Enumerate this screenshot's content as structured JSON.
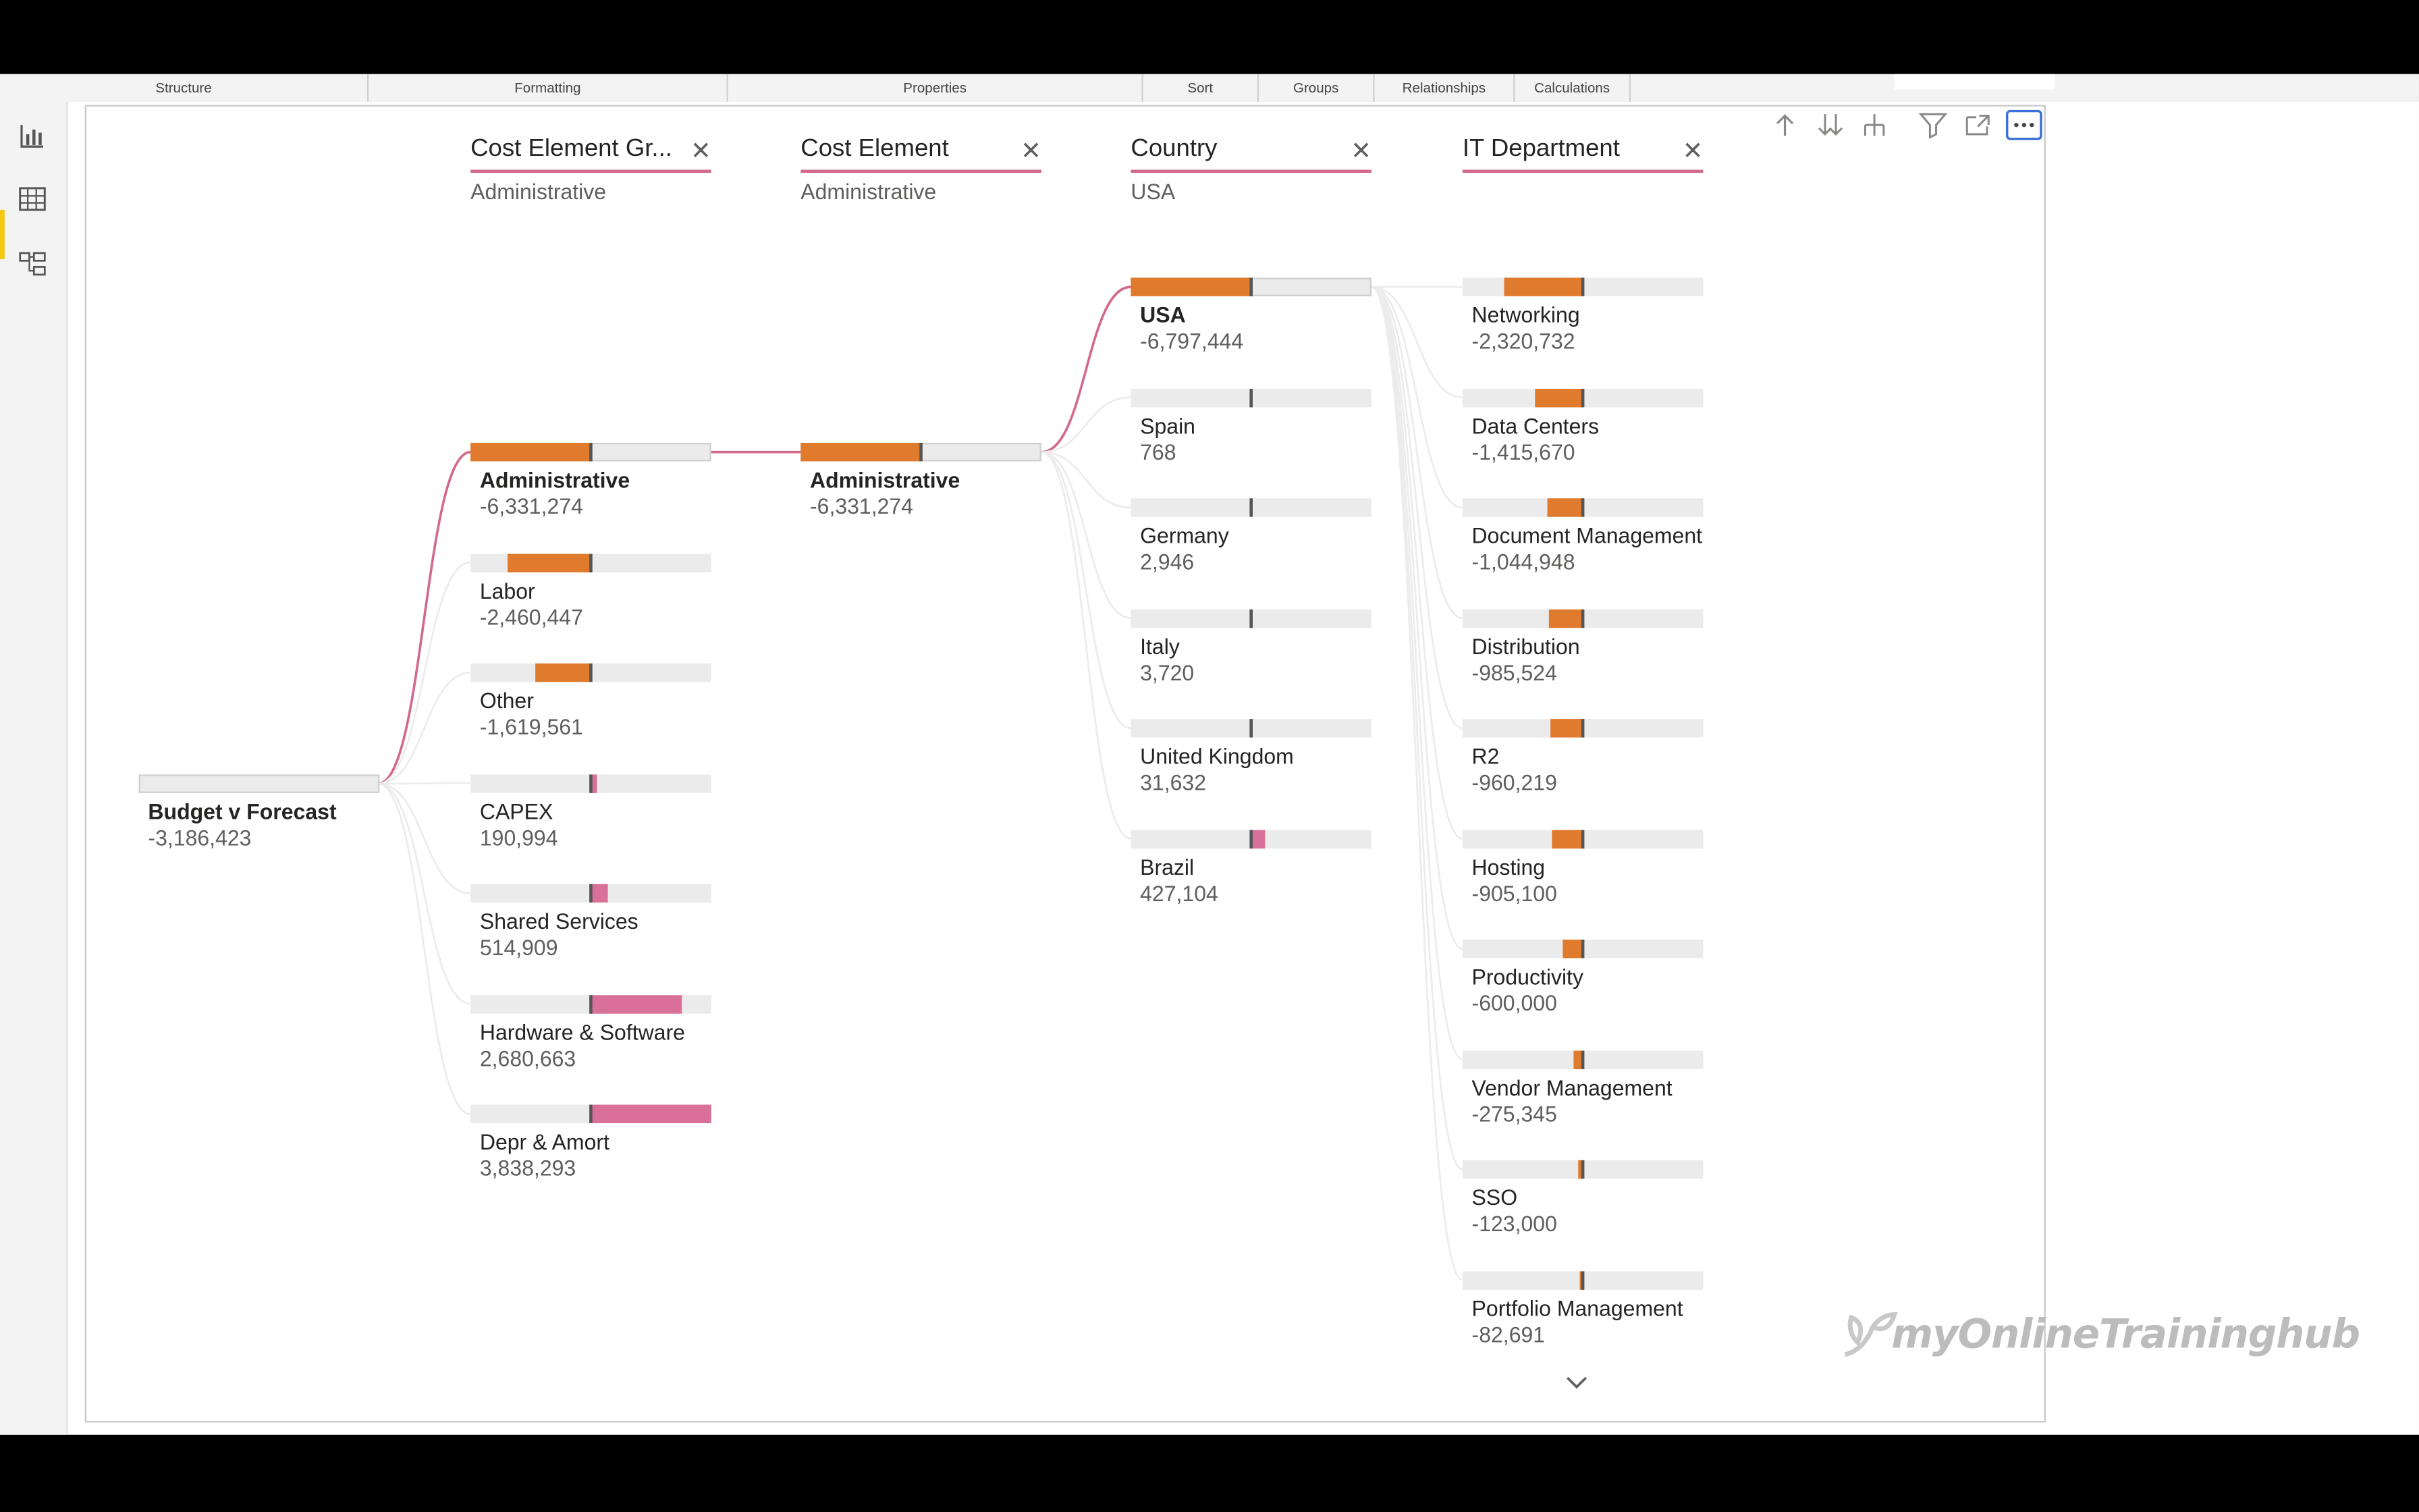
{
  "ribbon": {
    "groups": [
      "Structure",
      "Formatting",
      "Properties",
      "Sort",
      "Groups",
      "Relationships",
      "Calculations"
    ]
  },
  "left_rail": {
    "icons": [
      "report-view-icon",
      "data-view-icon",
      "model-view-icon"
    ]
  },
  "toolbar": {
    "icons": [
      "drill-up-icon",
      "expand-all-icon",
      "hierarchy-icon",
      "filter-icon",
      "focus-mode-icon",
      "more-options-icon"
    ]
  },
  "colors": {
    "negative": "#e07a2c",
    "positive": "#d9709a",
    "link": "#d26a8a",
    "track": "#ebebeb"
  },
  "root": {
    "label": "Budget v Forecast",
    "value": "-3,186,423",
    "num": -3186423
  },
  "levels": [
    {
      "header": "Cost Element Gr...",
      "subtitle": "Administrative",
      "nodes": [
        {
          "label": "Administrative",
          "value": "-6,331,274",
          "num": -6331274,
          "selected": true
        },
        {
          "label": "Labor",
          "value": "-2,460,447",
          "num": -2460447
        },
        {
          "label": "Other",
          "value": "-1,619,561",
          "num": -1619561
        },
        {
          "label": "CAPEX",
          "value": "190,994",
          "num": 190994
        },
        {
          "label": "Shared Services",
          "value": "514,909",
          "num": 514909
        },
        {
          "label": "Hardware & Software",
          "value": "2,680,663",
          "num": 2680663
        },
        {
          "label": "Depr & Amort",
          "value": "3,838,293",
          "num": 3838293
        }
      ]
    },
    {
      "header": "Cost Element",
      "subtitle": "Administrative",
      "nodes": [
        {
          "label": "Administrative",
          "value": "-6,331,274",
          "num": -6331274,
          "selected": true
        }
      ]
    },
    {
      "header": "Country",
      "subtitle": "USA",
      "nodes": [
        {
          "label": "USA",
          "value": "-6,797,444",
          "num": -6797444,
          "selected": true
        },
        {
          "label": "Spain",
          "value": "768",
          "num": 768
        },
        {
          "label": "Germany",
          "value": "2,946",
          "num": 2946
        },
        {
          "label": "Italy",
          "value": "3,720",
          "num": 3720
        },
        {
          "label": "United Kingdom",
          "value": "31,632",
          "num": 31632
        },
        {
          "label": "Brazil",
          "value": "427,104",
          "num": 427104
        }
      ]
    },
    {
      "header": "IT Department",
      "subtitle": "",
      "nodes": [
        {
          "label": "Networking",
          "value": "-2,320,732",
          "num": -2320732
        },
        {
          "label": "Data Centers",
          "value": "-1,415,670",
          "num": -1415670
        },
        {
          "label": "Document Management",
          "value": "-1,044,948",
          "num": -1044948
        },
        {
          "label": "Distribution",
          "value": "-985,524",
          "num": -985524
        },
        {
          "label": "R2",
          "value": "-960,219",
          "num": -960219
        },
        {
          "label": "Hosting",
          "value": "-905,100",
          "num": -905100
        },
        {
          "label": "Productivity",
          "value": "-600,000",
          "num": -600000
        },
        {
          "label": "Vendor Management",
          "value": "-275,345",
          "num": -275345
        },
        {
          "label": "SSO",
          "value": "-123,000",
          "num": -123000
        },
        {
          "label": "Portfolio Management",
          "value": "-82,691",
          "num": -82691
        }
      ]
    }
  ],
  "watermark": "myOnlineTraininghub"
}
